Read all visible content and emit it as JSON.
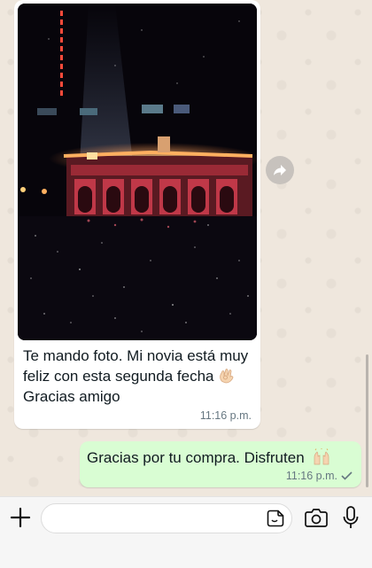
{
  "messages": [
    {
      "direction": "incoming",
      "has_photo": true,
      "text_before_emoji": "Te mando foto. Mi novia está muy feliz con esta segunda fecha",
      "emoji_1": "ok-hand",
      "text_after_emoji": "Gracias amigo",
      "time": "11:16 p.m."
    },
    {
      "direction": "outgoing",
      "text": "Gracias por tu compra. Disfruten",
      "emoji_1": "raising-hands",
      "time": "11:16 p.m.",
      "status": "sent"
    }
  ],
  "composer": {
    "placeholder": "",
    "value": ""
  },
  "colors": {
    "incoming_bubble": "#ffffff",
    "outgoing_bubble": "#d9fdd3",
    "chat_background": "#efe7dd",
    "timestamp": "#667781"
  },
  "icons": {
    "attach": "plus-icon",
    "forward": "forward-arrow-icon",
    "sticker": "sticker-icon",
    "camera": "camera-icon",
    "mic": "microphone-icon"
  }
}
